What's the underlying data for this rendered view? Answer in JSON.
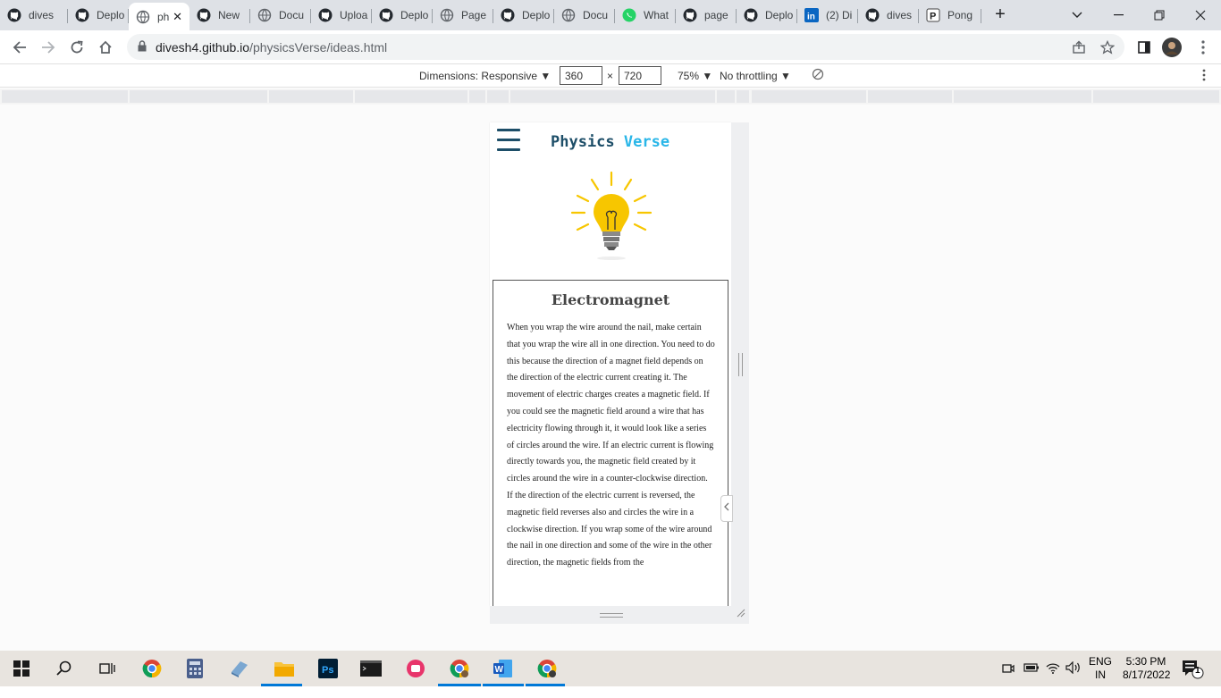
{
  "browser": {
    "tabs": [
      {
        "label": "dives",
        "icon": "github-icon"
      },
      {
        "label": "Deplo",
        "icon": "github-icon"
      },
      {
        "label": "ph",
        "icon": "globe-icon",
        "active": true
      },
      {
        "label": "New",
        "icon": "github-icon"
      },
      {
        "label": "Docu",
        "icon": "globe-icon"
      },
      {
        "label": "Uploa",
        "icon": "github-icon"
      },
      {
        "label": "Deplo",
        "icon": "github-icon"
      },
      {
        "label": "Page",
        "icon": "globe-icon"
      },
      {
        "label": "Deplo",
        "icon": "github-icon"
      },
      {
        "label": "Docu",
        "icon": "globe-icon"
      },
      {
        "label": "What",
        "icon": "whatsapp-icon"
      },
      {
        "label": "page",
        "icon": "github-icon"
      },
      {
        "label": "Deplo",
        "icon": "github-icon"
      },
      {
        "label": "(2) Di",
        "icon": "linkedin-icon"
      },
      {
        "label": "dives",
        "icon": "github-icon"
      },
      {
        "label": "Pong",
        "icon": "page-icon"
      }
    ],
    "new_tab_label": "+",
    "url_host": "divesh4.github.io",
    "url_path": "/physicsVerse/ideas.html"
  },
  "devtools": {
    "dimensions_label": "Dimensions: Responsive ▼",
    "width": "360",
    "times": "×",
    "height": "720",
    "zoom": "75% ▼",
    "throttling": "No throttling ▼"
  },
  "page": {
    "brand_part1": "Physics",
    "brand_part2": "Verse",
    "card_title": "Electromagnet",
    "card_text": "When you wrap the wire around the nail, make certain that you wrap the wire all in one direction. You need to do this because the direction of a magnet field depends on the direction of the electric current creating it. The movement of electric charges creates a magnetic field. If you could see the magnetic field around a wire that has electricity flowing through it, it would look like a series of circles around the wire. If an electric current is flowing directly towards you, the magnetic field created by it circles around the wire in a counter-clockwise direction. If the direction of the electric current is reversed, the magnetic field reverses also and circles the wire in a clockwise direction. If you wrap some of the wire around the nail in one direction and some of the wire in the other direction, the magnetic fields from the"
  },
  "taskbar": {
    "lang_top": "ENG",
    "lang_bottom": "IN",
    "time": "5:30 PM",
    "date": "8/17/2022",
    "notification_count": "1"
  },
  "colors": {
    "brand_dark": "#1d4e68",
    "brand_light": "#29b6e8",
    "bulb": "#f7c600"
  }
}
